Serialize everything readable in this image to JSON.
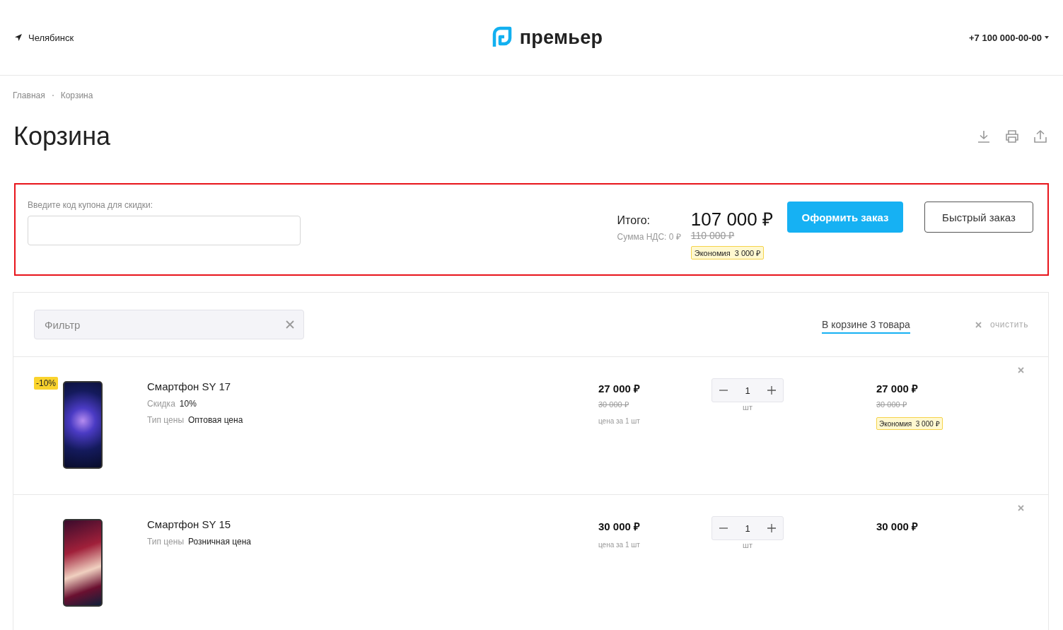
{
  "header": {
    "city": "Челябинск",
    "logo": "премьер",
    "phone": "+7 100 000-00-00"
  },
  "breadcrumbs": [
    {
      "label": "Главная"
    },
    {
      "label": "Корзина"
    }
  ],
  "title": "Корзина",
  "coupon": {
    "label": "Введите код купона для скидки:",
    "highlighted": true
  },
  "summary": {
    "total_label": "Итого:",
    "vat": "Сумма НДС: 0 ₽",
    "total": "107 000 ₽",
    "old_total": "110 000 ₽",
    "savings_label": "Экономия",
    "savings": "3 000 ₽"
  },
  "buttons": [
    {
      "label": "Оформить заказ",
      "kind": "primary"
    },
    {
      "label": "Быстрый заказ",
      "kind": "outline"
    }
  ],
  "filter": {
    "placeholder": "Фильтр"
  },
  "cart_count": "В корзине 3 товара",
  "clear": "очистить",
  "items": [
    {
      "name": "Смартфон SY 17",
      "badge": "-10%",
      "props": [
        {
          "label": "Скидка",
          "value": "10%"
        },
        {
          "label": "Тип цены",
          "value": "Оптовая цена"
        }
      ],
      "price": "27 000 ₽",
      "old_price": "30 000 ₽",
      "unit_note": "цена за 1 шт",
      "qty": "1",
      "unit": "шт",
      "total": "27 000 ₽",
      "old_total": "30 000 ₽",
      "savings_label": "Экономия",
      "savings": "3 000 ₽"
    },
    {
      "name": "Смартфон SY 15",
      "props": [
        {
          "label": "Тип цены",
          "value": "Розничная цена"
        }
      ],
      "price": "30 000 ₽",
      "unit_note": "цена за 1 шт",
      "qty": "1",
      "unit": "шт",
      "total": "30 000 ₽"
    }
  ]
}
